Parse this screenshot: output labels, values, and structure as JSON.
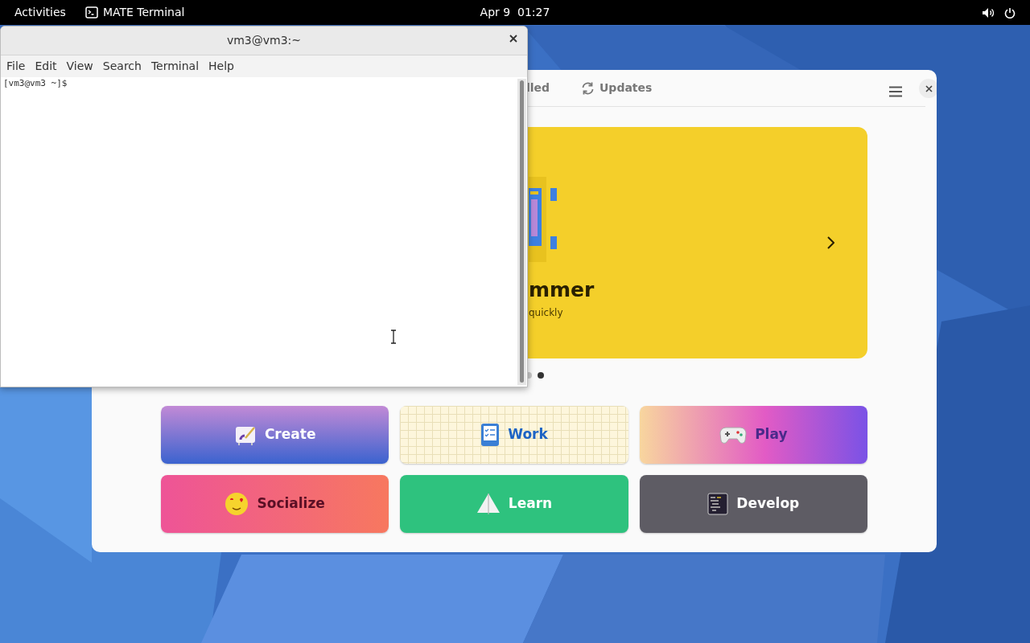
{
  "top_bar": {
    "activities": "Activities",
    "app_name": "MATE Terminal",
    "clock": "Apr 9  01:27"
  },
  "terminal": {
    "title": "vm3@vm3:~",
    "menu": [
      "File",
      "Edit",
      "View",
      "Search",
      "Terminal",
      "Help"
    ],
    "prompt": "[vm3@vm3 ~]$"
  },
  "software": {
    "tabs": [
      {
        "label": "lled",
        "selected": false
      },
      {
        "label": "Updates",
        "selected": false
      }
    ],
    "banner": {
      "title": "mmer",
      "subtitle": "quickly"
    },
    "dots": [
      {
        "selected": false
      },
      {
        "selected": true
      }
    ],
    "categories": [
      {
        "label": "Create",
        "kind": "create"
      },
      {
        "label": "Work",
        "kind": "work"
      },
      {
        "label": "Play",
        "kind": "play"
      },
      {
        "label": "Socialize",
        "kind": "socialize"
      },
      {
        "label": "Learn",
        "kind": "learn"
      },
      {
        "label": "Develop",
        "kind": "develop"
      }
    ]
  }
}
